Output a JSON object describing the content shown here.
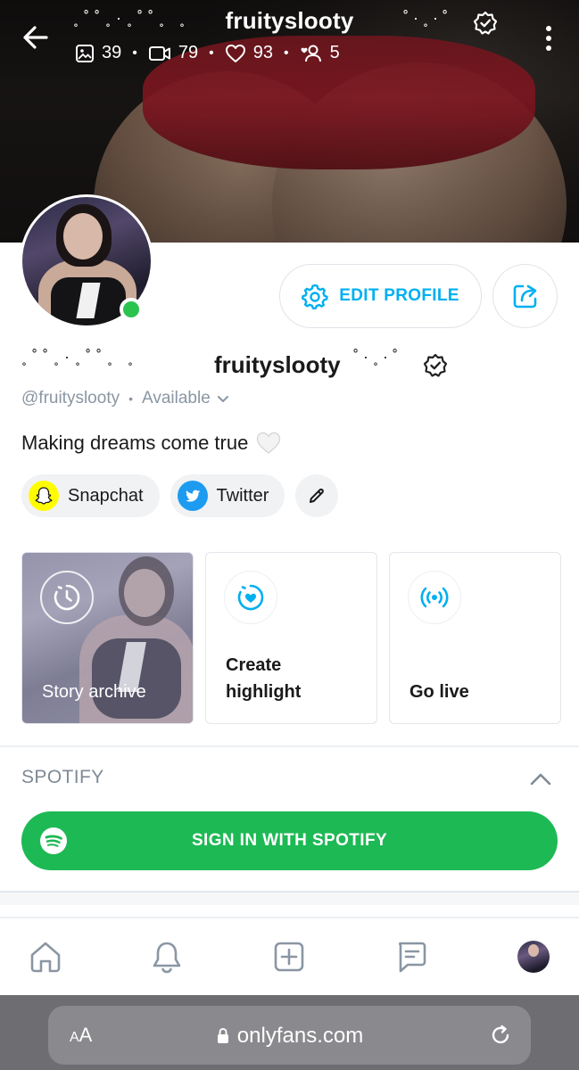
{
  "profile": {
    "display_name": "fruityslooty",
    "name_deco_left": "˳˚˚˳·˳˚˚˳ ˳",
    "name_deco_right": "˚·˳·˚",
    "handle": "@fruityslooty",
    "availability": "Available",
    "bio": "Making dreams come true"
  },
  "stats": {
    "photos": "39",
    "videos": "79",
    "likes": "93",
    "fans": "5"
  },
  "actions": {
    "edit_profile_label": "EDIT PROFILE"
  },
  "social_links": [
    {
      "label": "Snapchat",
      "icon": "snapchat-icon",
      "color": "#fffc00"
    },
    {
      "label": "Twitter",
      "icon": "twitter-icon",
      "color": "#1d9bf0"
    }
  ],
  "highlights": {
    "archive_label": "Story archive",
    "create_label_1": "Create",
    "create_label_2": "highlight",
    "live_label": "Go live"
  },
  "spotify": {
    "title": "SPOTIFY",
    "button_label": "SIGN IN WITH SPOTIFY"
  },
  "browser": {
    "aa_big": "A",
    "aa_small": "A",
    "url": "onlyfans.com"
  },
  "colors": {
    "accent": "#00aff0",
    "spotify_green": "#1db954",
    "online": "#2ac34e",
    "muted": "#8a96a3"
  }
}
